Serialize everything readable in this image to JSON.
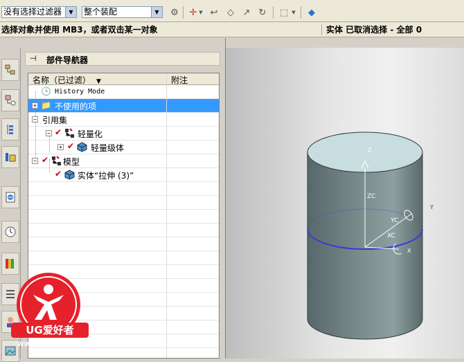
{
  "toolbar": {
    "filter_combo": "没有选择过滤器",
    "assembly_combo": "整个装配",
    "icons": [
      "gear-icon",
      "snap-point-icon",
      "undo-arrow-icon",
      "select-face-icon",
      "move-handle-icon",
      "rotate-icon",
      "selection-box-icon",
      "cube-view-icon"
    ]
  },
  "status": {
    "prompt": "选择对象并使用 MB3，或者双击某一对象",
    "selection_info": "实体 已取消选择 - 全部 0"
  },
  "navigator": {
    "title": "部件导航器",
    "columns": {
      "name": "名称（已过滤）",
      "note": "附注"
    },
    "rows": [
      {
        "label": "History Mode",
        "icon": "clock-icon"
      },
      {
        "label": "不使用的项",
        "icon": "folder-icon"
      },
      {
        "label": "引用集",
        "icon": "none"
      },
      {
        "label": "轻量化",
        "icon": "assembly-icon"
      },
      {
        "label": "轻量级体",
        "icon": "body-icon"
      },
      {
        "label": "模型",
        "icon": "assembly-icon"
      },
      {
        "label": "实体“拉伸 (3)”",
        "icon": "body-icon"
      }
    ]
  },
  "resource_bar": {
    "icons": [
      "assembly-navigator-icon",
      "part-navigator-icon",
      "constraint-navigator-icon",
      "reuse-library-icon",
      "web-browser-icon",
      "history-icon",
      "system-materials-icon",
      "process-studio-icon",
      "roles-icon",
      "palette-icon"
    ]
  },
  "viewport": {
    "axis_labels": {
      "z_top": "Z",
      "zc": "ZC",
      "yc": "YC",
      "y": "Y",
      "xc": "XC",
      "x": "X"
    },
    "body_color": "#5f6e6e",
    "top_face_color": "#c8dde0",
    "edge_highlight_color": "#3b3bdc"
  },
  "watermark": {
    "brand": "UG爱好者",
    "url": "WWW.UGSNX.COM"
  }
}
